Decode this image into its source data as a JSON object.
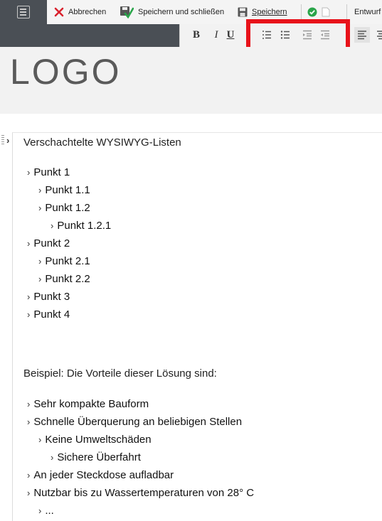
{
  "toolbar": {
    "cancel_label": "Abbrechen",
    "save_close_label": "Speichern und schließen",
    "save_label": "Speichern",
    "status_label": "Entwurf"
  },
  "format": {
    "bold": "B",
    "italic": "I",
    "underline": "U"
  },
  "header": {
    "logo_text": "LOGO"
  },
  "content": {
    "heading": "Verschachtelte WYSIWYG-Listen",
    "list1": [
      {
        "bullet": "›",
        "text": "Punkt 1"
      },
      {
        "bullet": "›",
        "text": "Punkt 1.1"
      },
      {
        "bullet": "›",
        "text": "Punkt 1.2"
      },
      {
        "bullet": "›",
        "text": "Punkt 1.2.1"
      },
      {
        "bullet": "›",
        "text": "Punkt 2"
      },
      {
        "bullet": "›",
        "text": "Punkt 2.1"
      },
      {
        "bullet": "›",
        "text": "Punkt 2.2"
      },
      {
        "bullet": "›",
        "text": "Punkt 3"
      },
      {
        "bullet": "›",
        "text": "Punkt 4"
      }
    ],
    "example_heading": "Beispiel: Die Vorteile dieser Lösung sind:",
    "list2": [
      {
        "bullet": "›",
        "text": "Sehr kompakte Bauform"
      },
      {
        "bullet": "›",
        "text": "Schnelle Überquerung an beliebigen Stellen"
      },
      {
        "bullet": "›",
        "text": "Keine Umweltschäden"
      },
      {
        "bullet": "›",
        "text": "Sichere Überfahrt"
      },
      {
        "bullet": "›",
        "text": "An jeder Steckdose aufladbar"
      },
      {
        "bullet": "›",
        "text": "Nutzbar bis zu Wassertemperaturen von 28° C"
      },
      {
        "bullet": "›",
        "text": "..."
      }
    ]
  },
  "colors": {
    "toolbar_dark": "#4a4f55",
    "highlight": "#e8121a",
    "cancel_red": "#d9232e",
    "ok_green": "#2aa54a"
  }
}
